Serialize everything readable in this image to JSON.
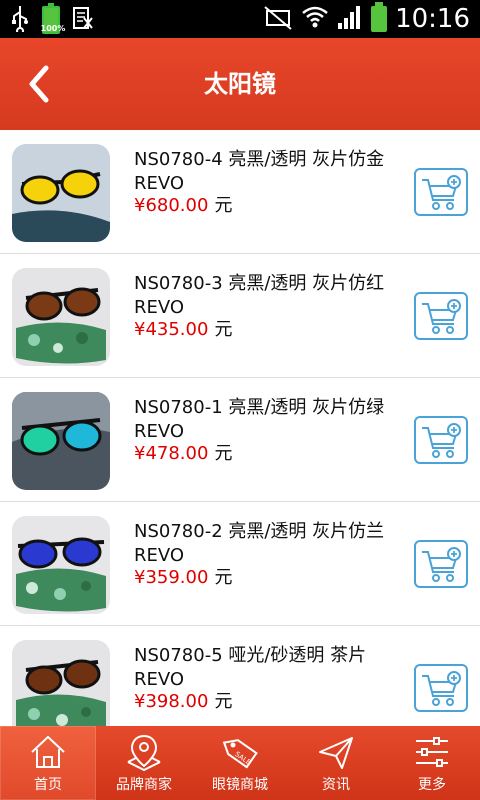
{
  "status_bar": {
    "battery_left_pct": "100%",
    "time": "10:16"
  },
  "header": {
    "title": "太阳镜"
  },
  "products": [
    {
      "name": "NS0780-4  亮黑/透明 灰片仿金REVO",
      "price": "¥680.00",
      "unit": "元",
      "lens_color": "#f5d20a"
    },
    {
      "name": "NS0780-3  亮黑/透明 灰片仿红REVO",
      "price": "¥435.00",
      "unit": "元",
      "lens_color": "#7a3a16"
    },
    {
      "name": "NS0780-1  亮黑/透明 灰片仿绿REVO",
      "price": "¥478.00",
      "unit": "元",
      "lens_color": "#20d0a0"
    },
    {
      "name": "NS0780-2  亮黑/透明 灰片仿兰REVO",
      "price": "¥359.00",
      "unit": "元",
      "lens_color": "#2a3ad0"
    },
    {
      "name": "NS0780-5   哑光/砂透明  茶片REVO",
      "price": "¥398.00",
      "unit": "元",
      "lens_color": "#6e3212"
    }
  ],
  "tabs": [
    {
      "label": "首页",
      "icon": "home-icon"
    },
    {
      "label": "品牌商家",
      "icon": "map-pin-icon"
    },
    {
      "label": "眼镜商城",
      "icon": "sale-tag-icon"
    },
    {
      "label": "资讯",
      "icon": "send-icon"
    },
    {
      "label": "更多",
      "icon": "sliders-icon"
    }
  ],
  "colors": {
    "accent": "#d9401f",
    "price": "#e00000",
    "cart_border": "#4aa3d8"
  }
}
